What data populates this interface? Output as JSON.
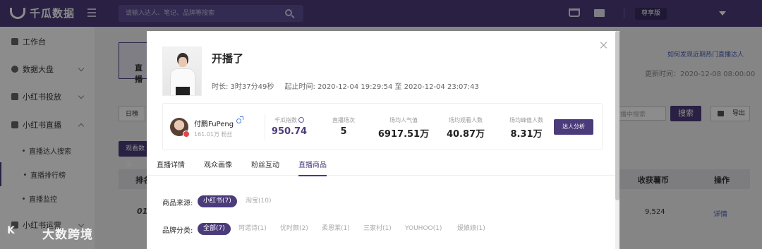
{
  "header": {
    "brand": "千瓜数据",
    "search_placeholder": "请输入达人、笔记、品牌等搜索",
    "plan_badge": "尊享版"
  },
  "sidebar": {
    "items": [
      {
        "label": "工作台"
      },
      {
        "label": "数据大盘"
      },
      {
        "label": "小红书投放"
      },
      {
        "label": "小红书直播"
      },
      {
        "label": "直播达人搜索"
      },
      {
        "label": "直播排行榜"
      },
      {
        "label": "直播监控"
      },
      {
        "label": "小红书运营"
      }
    ]
  },
  "background_page": {
    "card_label": "直播",
    "help_link": "如何发现近期热门直播达人",
    "update_time": "更新时间：2020-12-08 08:00:00",
    "tab_daily": "日榜",
    "search_placeholder": "播中搜索",
    "search_button": "搜索",
    "export_button": "导出",
    "watch_button": "观看数据",
    "table_headers": {
      "rank": "排名",
      "coins": "收获薯币",
      "action": "操作"
    },
    "row": {
      "rank": "01",
      "coins": "9,524",
      "action": "详情"
    }
  },
  "modal": {
    "live_title": "开播了",
    "duration": "时长: 3时37分49秒",
    "time_range": "起止时间: 2020-12-04 19:29:54 至 2020-12-04 23:07:43",
    "kol": {
      "name": "付鹏FuPeng",
      "fans": "161.01万 粉丝"
    },
    "stats": [
      {
        "label": "千瓜指数",
        "value": "950.74"
      },
      {
        "label": "直播场次",
        "value": "5"
      },
      {
        "label": "场均人气值",
        "value": "6917.51万"
      },
      {
        "label": "场均观看人数",
        "value": "40.87万"
      },
      {
        "label": "场均峰值人数",
        "value": "8.31万"
      }
    ],
    "analyze_button": "达人分析",
    "tabs": [
      "直播详情",
      "观众画像",
      "粉丝互动",
      "直播商品"
    ],
    "source_filter": {
      "label": "商品来源:",
      "options": [
        "小红书(7)",
        "淘宝(10)"
      ]
    },
    "brand_filter": {
      "label": "品牌分类:",
      "options": [
        "全部(7)",
        "珂诺诗(1)",
        "优时颜(2)",
        "柔恩莱(1)",
        "三家村(1)",
        "YOUHOO(1)",
        "嫒娘娘(1)"
      ]
    }
  },
  "watermark": {
    "mark": "K",
    "text": "大数跨境"
  },
  "colors": {
    "primary": "#4b3b7a",
    "link": "#4b62b8",
    "overlay": "rgba(0,0,0,0.45)"
  }
}
